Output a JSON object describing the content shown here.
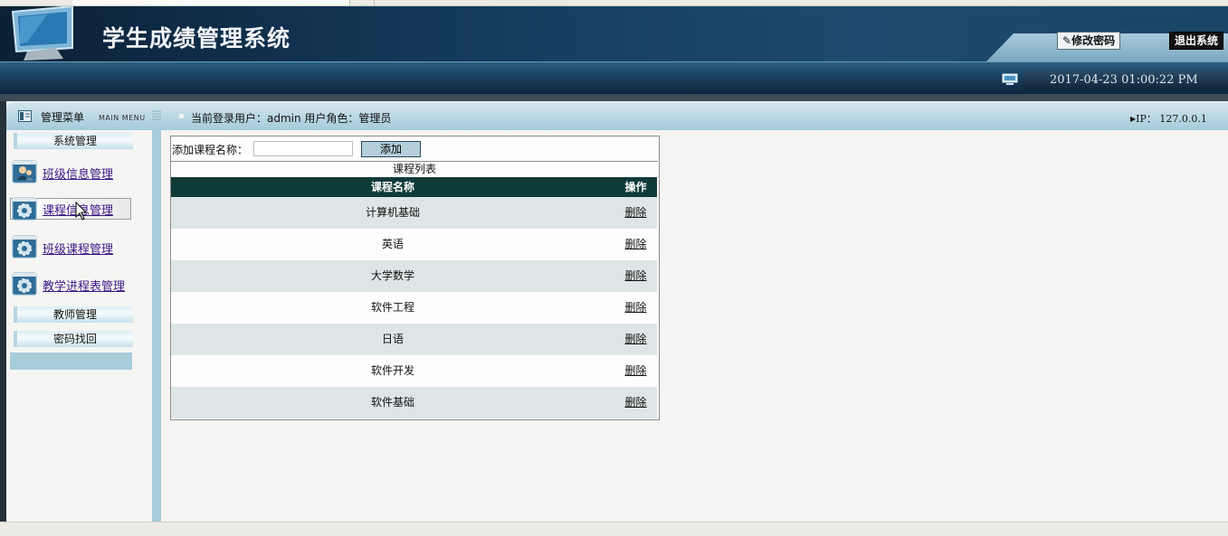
{
  "header": {
    "app_title": "学生成绩管理系统",
    "change_password_label": "修改密码",
    "exit_label": "退出系统",
    "datetime": "2017-04-23 01:00:22 PM"
  },
  "menubar": {
    "menu_title": "管理菜单",
    "menu_title_en": "MAIN MENU",
    "user_info": "当前登录用户：admin 用户角色：管理员",
    "ip_label": "IP：",
    "ip_value": "127.0.0.1"
  },
  "sidebar": {
    "section_system": "系统管理",
    "items": [
      {
        "label": "班级信息管理",
        "icon": "student-icon"
      },
      {
        "label": "课程信息管理",
        "icon": "gear-icon"
      },
      {
        "label": "班级课程管理",
        "icon": "gear-icon"
      },
      {
        "label": "教学进程表管理",
        "icon": "gear-icon"
      }
    ],
    "section_teacher": "教师管理",
    "section_password": "密码找回"
  },
  "main": {
    "add_label": "添加课程名称：",
    "add_input_value": "",
    "add_button": "添加",
    "list_title": "课程列表",
    "columns": [
      "课程名称",
      "操作"
    ],
    "rows": [
      {
        "name": "计算机基础",
        "action": "删除"
      },
      {
        "name": "英语",
        "action": "删除"
      },
      {
        "name": "大学数学",
        "action": "删除"
      },
      {
        "name": "软件工程",
        "action": "删除"
      },
      {
        "name": "日语",
        "action": "删除"
      },
      {
        "name": "软件开发",
        "action": "删除"
      },
      {
        "name": "软件基础",
        "action": "删除"
      }
    ]
  },
  "colors": {
    "header_dark": "#14395a",
    "table_header": "#0e3b38",
    "row_alt": "#dde6e6",
    "link": "#3c1786"
  }
}
